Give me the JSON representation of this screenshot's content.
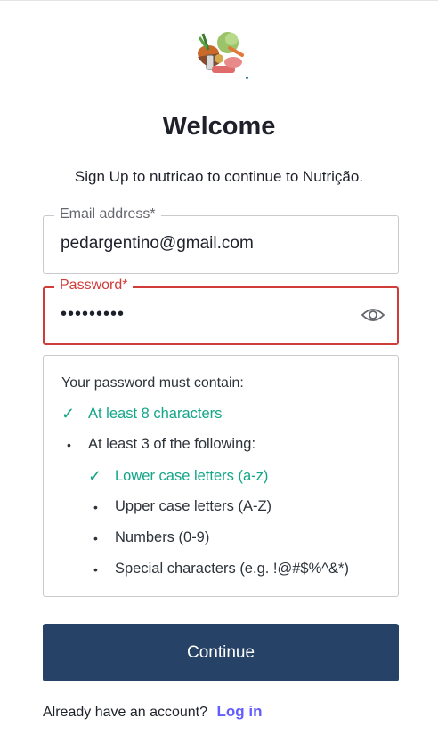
{
  "header": {
    "logo_icon": "vegetable-basket-logo",
    "title": "Welcome",
    "subtitle": "Sign Up to nutricao to continue to Nutrição."
  },
  "form": {
    "email": {
      "label": "Email address*",
      "value": "pedargentino@gmail.com"
    },
    "password": {
      "label": "Password*",
      "value": "•••••••••",
      "toggle_icon": "eye-icon"
    }
  },
  "password_rules": {
    "heading": "Your password must contain:",
    "items": [
      {
        "text": "At least 8 characters",
        "status": "met",
        "level": 0
      },
      {
        "text": "At least 3 of the following:",
        "status": "unmet",
        "level": 0
      },
      {
        "text": "Lower case letters (a-z)",
        "status": "met",
        "level": 1
      },
      {
        "text": "Upper case letters (A-Z)",
        "status": "unmet",
        "level": 1
      },
      {
        "text": "Numbers (0-9)",
        "status": "unmet",
        "level": 1
      },
      {
        "text": "Special characters (e.g. !@#$%^&*)",
        "status": "unmet",
        "level": 1
      }
    ],
    "check_glyph": "✓",
    "bullet_glyph": "•"
  },
  "actions": {
    "continue_label": "Continue"
  },
  "footer": {
    "prompt": "Already have an account?",
    "login_label": "Log in"
  },
  "colors": {
    "error": "#d03c38",
    "success": "#13a688",
    "primary_button": "#264266",
    "link": "#635dff"
  }
}
